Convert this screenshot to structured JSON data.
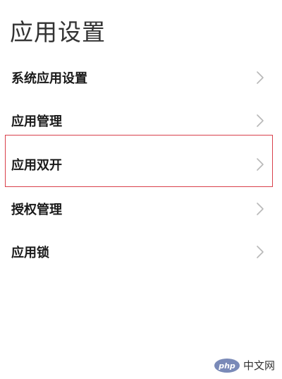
{
  "header": {
    "title": "应用设置"
  },
  "menu": {
    "items": [
      {
        "label": "系统应用设置",
        "icon": "chevron-right-icon"
      },
      {
        "label": "应用管理",
        "icon": "chevron-right-icon"
      },
      {
        "label": "应用双开",
        "icon": "chevron-right-icon"
      },
      {
        "label": "授权管理",
        "icon": "chevron-right-icon"
      },
      {
        "label": "应用锁",
        "icon": "chevron-right-icon"
      }
    ],
    "highlighted_item": "应用双开"
  },
  "colors": {
    "highlight_border": "#d9404b",
    "chevron": "#b8b8b8",
    "text": "#1a1a1a",
    "watermark_badge": "#7a8ab8"
  },
  "watermark": {
    "badge": "php",
    "text": "中文网"
  }
}
